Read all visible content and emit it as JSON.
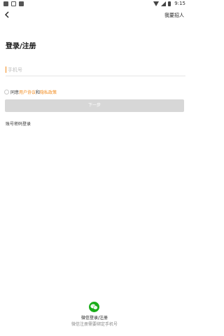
{
  "status_bar": {
    "time": "9:15"
  },
  "header": {
    "back_icon": "back-arrow-icon",
    "recruit_label": "我要招人"
  },
  "main": {
    "title": "登录/注册",
    "phone_placeholder": "手机号",
    "agreement": {
      "prefix": "同意",
      "user_agreement": "用户协议",
      "connector": "和",
      "privacy_policy": "隐私政策"
    },
    "next_label": "下一步",
    "password_login_label": "账号密码登录"
  },
  "footer": {
    "wechat_label": "微信登录/注册",
    "wechat_note": "微信注册需要绑定手机号"
  },
  "colors": {
    "accent": "#f28a1b",
    "wechat": "#1aad19",
    "button_disabled": "#d7d7d7"
  }
}
